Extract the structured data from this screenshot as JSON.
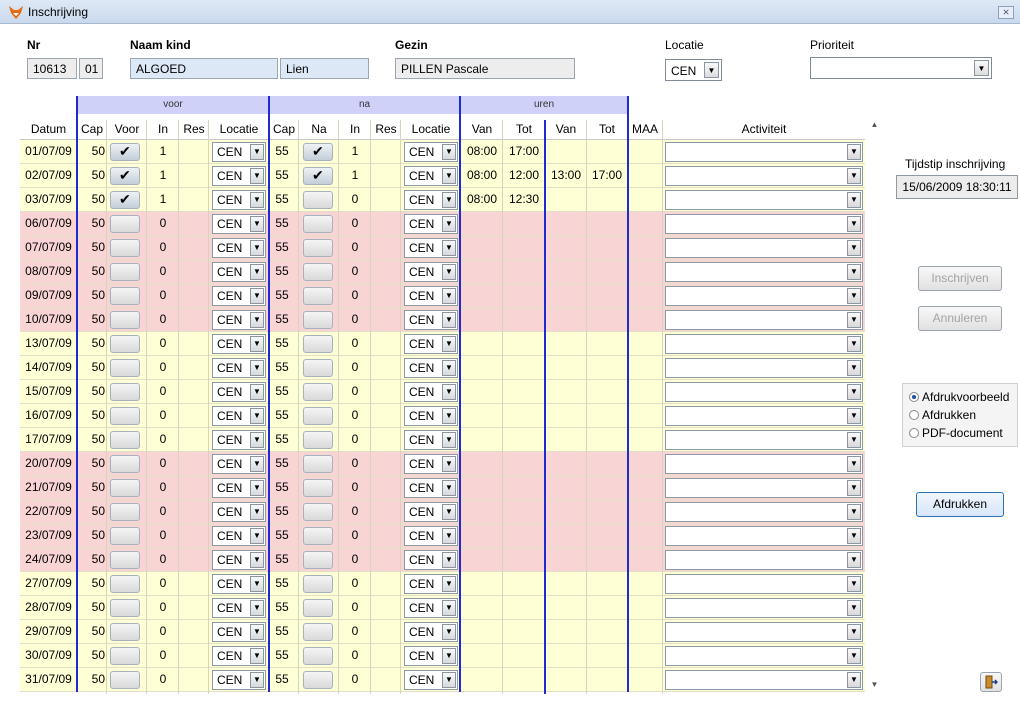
{
  "window": {
    "title": "Inschrijving",
    "close_glyph": "⨯"
  },
  "header": {
    "nr_label": "Nr",
    "nr_value": "10613",
    "nr_sub": "01",
    "naam_label": "Naam kind",
    "achternaam": "ALGOED",
    "voornaam": "Lien",
    "gezin_label": "Gezin",
    "gezin_value": "PILLEN Pascale",
    "locatie_label": "Locatie",
    "locatie_value": "CEN",
    "prioriteit_label": "Prioriteit",
    "prioriteit_value": ""
  },
  "bands": {
    "voor": "voor",
    "na": "na",
    "uren": "uren"
  },
  "columns": {
    "datum": "Datum",
    "cap": "Cap",
    "voor": "Voor",
    "in": "In",
    "res": "Res",
    "locatie": "Locatie",
    "cap2": "Cap",
    "na": "Na",
    "in2": "In",
    "res2": "Res",
    "locatie2": "Locatie",
    "van": "Van",
    "tot": "Tot",
    "van2": "Van",
    "tot2": "Tot",
    "maa": "MAA",
    "activiteit": "Activiteit"
  },
  "rows": [
    {
      "datum": "01/07/09",
      "cap": "50",
      "voor": true,
      "in": "1",
      "loc": "CEN",
      "cap2": "55",
      "na": true,
      "in2": "1",
      "loc2": "CEN",
      "van": "08:00",
      "tot": "17:00",
      "van2": "",
      "tot2": "",
      "color": "yellow"
    },
    {
      "datum": "02/07/09",
      "cap": "50",
      "voor": true,
      "in": "1",
      "loc": "CEN",
      "cap2": "55",
      "na": true,
      "in2": "1",
      "loc2": "CEN",
      "van": "08:00",
      "tot": "12:00",
      "van2": "13:00",
      "tot2": "17:00",
      "color": "yellow"
    },
    {
      "datum": "03/07/09",
      "cap": "50",
      "voor": true,
      "in": "1",
      "loc": "CEN",
      "cap2": "55",
      "na": false,
      "in2": "0",
      "loc2": "CEN",
      "van": "08:00",
      "tot": "12:30",
      "van2": "",
      "tot2": "",
      "color": "yellow"
    },
    {
      "datum": "06/07/09",
      "cap": "50",
      "voor": false,
      "in": "0",
      "loc": "CEN",
      "cap2": "55",
      "na": false,
      "in2": "0",
      "loc2": "CEN",
      "van": "",
      "tot": "",
      "van2": "",
      "tot2": "",
      "color": "pink"
    },
    {
      "datum": "07/07/09",
      "cap": "50",
      "voor": false,
      "in": "0",
      "loc": "CEN",
      "cap2": "55",
      "na": false,
      "in2": "0",
      "loc2": "CEN",
      "van": "",
      "tot": "",
      "van2": "",
      "tot2": "",
      "color": "pink"
    },
    {
      "datum": "08/07/09",
      "cap": "50",
      "voor": false,
      "in": "0",
      "loc": "CEN",
      "cap2": "55",
      "na": false,
      "in2": "0",
      "loc2": "CEN",
      "van": "",
      "tot": "",
      "van2": "",
      "tot2": "",
      "color": "pink"
    },
    {
      "datum": "09/07/09",
      "cap": "50",
      "voor": false,
      "in": "0",
      "loc": "CEN",
      "cap2": "55",
      "na": false,
      "in2": "0",
      "loc2": "CEN",
      "van": "",
      "tot": "",
      "van2": "",
      "tot2": "",
      "color": "pink"
    },
    {
      "datum": "10/07/09",
      "cap": "50",
      "voor": false,
      "in": "0",
      "loc": "CEN",
      "cap2": "55",
      "na": false,
      "in2": "0",
      "loc2": "CEN",
      "van": "",
      "tot": "",
      "van2": "",
      "tot2": "",
      "color": "pink"
    },
    {
      "datum": "13/07/09",
      "cap": "50",
      "voor": false,
      "in": "0",
      "loc": "CEN",
      "cap2": "55",
      "na": false,
      "in2": "0",
      "loc2": "CEN",
      "van": "",
      "tot": "",
      "van2": "",
      "tot2": "",
      "color": "yellow"
    },
    {
      "datum": "14/07/09",
      "cap": "50",
      "voor": false,
      "in": "0",
      "loc": "CEN",
      "cap2": "55",
      "na": false,
      "in2": "0",
      "loc2": "CEN",
      "van": "",
      "tot": "",
      "van2": "",
      "tot2": "",
      "color": "yellow"
    },
    {
      "datum": "15/07/09",
      "cap": "50",
      "voor": false,
      "in": "0",
      "loc": "CEN",
      "cap2": "55",
      "na": false,
      "in2": "0",
      "loc2": "CEN",
      "van": "",
      "tot": "",
      "van2": "",
      "tot2": "",
      "color": "yellow"
    },
    {
      "datum": "16/07/09",
      "cap": "50",
      "voor": false,
      "in": "0",
      "loc": "CEN",
      "cap2": "55",
      "na": false,
      "in2": "0",
      "loc2": "CEN",
      "van": "",
      "tot": "",
      "van2": "",
      "tot2": "",
      "color": "yellow"
    },
    {
      "datum": "17/07/09",
      "cap": "50",
      "voor": false,
      "in": "0",
      "loc": "CEN",
      "cap2": "55",
      "na": false,
      "in2": "0",
      "loc2": "CEN",
      "van": "",
      "tot": "",
      "van2": "",
      "tot2": "",
      "color": "yellow"
    },
    {
      "datum": "20/07/09",
      "cap": "50",
      "voor": false,
      "in": "0",
      "loc": "CEN",
      "cap2": "55",
      "na": false,
      "in2": "0",
      "loc2": "CEN",
      "van": "",
      "tot": "",
      "van2": "",
      "tot2": "",
      "color": "pink"
    },
    {
      "datum": "21/07/09",
      "cap": "50",
      "voor": false,
      "in": "0",
      "loc": "CEN",
      "cap2": "55",
      "na": false,
      "in2": "0",
      "loc2": "CEN",
      "van": "",
      "tot": "",
      "van2": "",
      "tot2": "",
      "color": "pink"
    },
    {
      "datum": "22/07/09",
      "cap": "50",
      "voor": false,
      "in": "0",
      "loc": "CEN",
      "cap2": "55",
      "na": false,
      "in2": "0",
      "loc2": "CEN",
      "van": "",
      "tot": "",
      "van2": "",
      "tot2": "",
      "color": "pink"
    },
    {
      "datum": "23/07/09",
      "cap": "50",
      "voor": false,
      "in": "0",
      "loc": "CEN",
      "cap2": "55",
      "na": false,
      "in2": "0",
      "loc2": "CEN",
      "van": "",
      "tot": "",
      "van2": "",
      "tot2": "",
      "color": "pink"
    },
    {
      "datum": "24/07/09",
      "cap": "50",
      "voor": false,
      "in": "0",
      "loc": "CEN",
      "cap2": "55",
      "na": false,
      "in2": "0",
      "loc2": "CEN",
      "van": "",
      "tot": "",
      "van2": "",
      "tot2": "",
      "color": "pink"
    },
    {
      "datum": "27/07/09",
      "cap": "50",
      "voor": false,
      "in": "0",
      "loc": "CEN",
      "cap2": "55",
      "na": false,
      "in2": "0",
      "loc2": "CEN",
      "van": "",
      "tot": "",
      "van2": "",
      "tot2": "",
      "color": "yellow"
    },
    {
      "datum": "28/07/09",
      "cap": "50",
      "voor": false,
      "in": "0",
      "loc": "CEN",
      "cap2": "55",
      "na": false,
      "in2": "0",
      "loc2": "CEN",
      "van": "",
      "tot": "",
      "van2": "",
      "tot2": "",
      "color": "yellow"
    },
    {
      "datum": "29/07/09",
      "cap": "50",
      "voor": false,
      "in": "0",
      "loc": "CEN",
      "cap2": "55",
      "na": false,
      "in2": "0",
      "loc2": "CEN",
      "van": "",
      "tot": "",
      "van2": "",
      "tot2": "",
      "color": "yellow"
    },
    {
      "datum": "30/07/09",
      "cap": "50",
      "voor": false,
      "in": "0",
      "loc": "CEN",
      "cap2": "55",
      "na": false,
      "in2": "0",
      "loc2": "CEN",
      "van": "",
      "tot": "",
      "van2": "",
      "tot2": "",
      "color": "yellow"
    },
    {
      "datum": "31/07/09",
      "cap": "50",
      "voor": false,
      "in": "0",
      "loc": "CEN",
      "cap2": "55",
      "na": false,
      "in2": "0",
      "loc2": "CEN",
      "van": "",
      "tot": "",
      "van2": "",
      "tot2": "",
      "color": "yellow"
    }
  ],
  "side": {
    "tijdstip_label": "Tijdstip inschrijving",
    "tijdstip_value": "15/06/2009 18:30:11",
    "inschrijven": "Inschrijven",
    "annuleren": "Annuleren",
    "radio_options": [
      "Afdrukvoorbeeld",
      "Afdrukken",
      "PDF-document"
    ],
    "radio_selected": 0,
    "afdrukken": "Afdrukken"
  },
  "icons": {
    "check": "✔",
    "dropdown": "▼",
    "scroll_up": "▲",
    "scroll_down": "▼",
    "exit": "exit-door-icon"
  },
  "colors": {
    "band": "#cfd1f8",
    "row_yellow": "#ffffd6",
    "row_pink": "#f9d4d4",
    "divider": "#1f2bd0"
  }
}
